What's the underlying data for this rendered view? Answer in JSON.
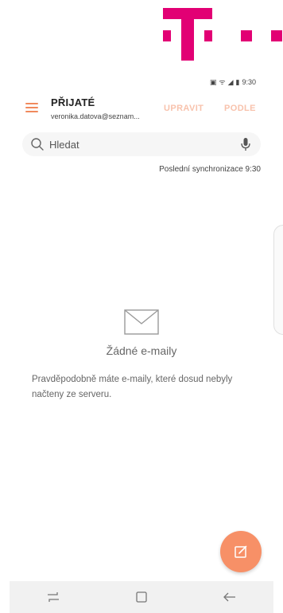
{
  "logo": {
    "name": "brand-logo",
    "color": "#e20074"
  },
  "statusbar": {
    "time": "9:30",
    "icons": [
      "nfc-icon",
      "volte-icon",
      "signal-icon",
      "battery-icon"
    ]
  },
  "header": {
    "title": "PŘIJATÉ",
    "account": "veronika.datova@seznam...",
    "edit_label": "UPRAVIT",
    "sort_label": "PODLE"
  },
  "search": {
    "placeholder": "Hledat",
    "value": ""
  },
  "sync_status": "Poslední synchronizace  9:30",
  "empty_state": {
    "title": "Žádné e-maily",
    "description": "Pravděpodobně máte e-maily, které dosud nebyly načteny ze serveru."
  },
  "colors": {
    "accent": "#f79067",
    "accent_light": "#f8c2ac",
    "brand": "#e20074"
  },
  "navbar": {
    "buttons": [
      "recent-apps-icon",
      "home-icon",
      "back-icon"
    ]
  }
}
